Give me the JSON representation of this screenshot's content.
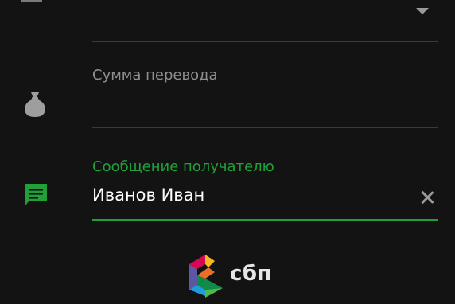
{
  "amount_field": {
    "label": "Сумма перевода",
    "icon": "money-bag-icon"
  },
  "message_field": {
    "label": "Сообщение получателю",
    "value": "Иванов Иван",
    "icon": "message-icon",
    "clear_icon": "close-icon"
  },
  "footer": {
    "brand_text": "сбп",
    "logo": "sbp-logo"
  },
  "colors": {
    "accent": "#21a038",
    "background": "#131313",
    "muted": "#8f8f8f"
  }
}
